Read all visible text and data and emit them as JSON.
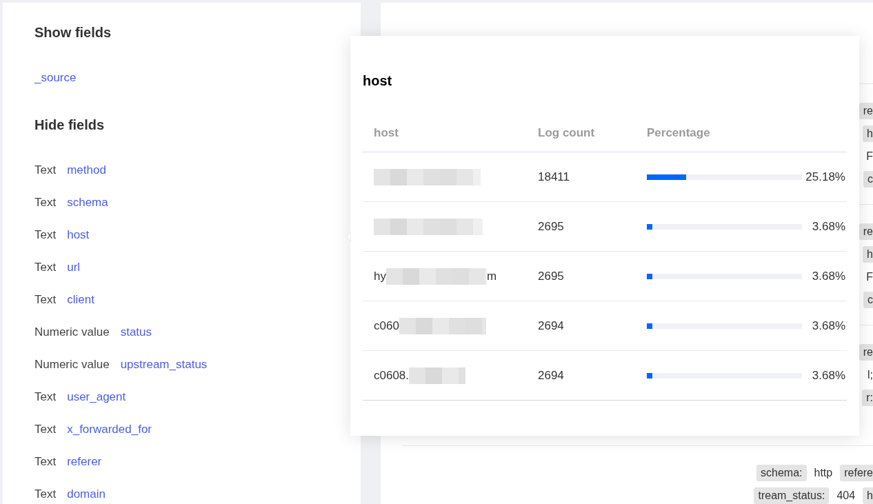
{
  "field_panel": {
    "shown": {
      "title": "Show fields",
      "fields": [
        {
          "name": "_source"
        }
      ]
    },
    "hidden": {
      "title": "Hide fields",
      "fields": [
        {
          "type": "Text",
          "name": "method"
        },
        {
          "type": "Text",
          "name": "schema"
        },
        {
          "type": "Text",
          "name": "host"
        },
        {
          "type": "Text",
          "name": "url"
        },
        {
          "type": "Text",
          "name": "client"
        },
        {
          "type": "Numeric value",
          "name": "status"
        },
        {
          "type": "Numeric value",
          "name": "upstream_status"
        },
        {
          "type": "Text",
          "name": "user_agent"
        },
        {
          "type": "Text",
          "name": "x_forwarded_for"
        },
        {
          "type": "Text",
          "name": "referer"
        },
        {
          "type": "Text",
          "name": "domain"
        }
      ]
    }
  },
  "field_popover": {
    "title": "host",
    "columns": [
      "host",
      "Log count",
      "Percentage"
    ],
    "rows": [
      {
        "redacted": true,
        "count": "18411",
        "level": 0.2518,
        "percentage": "25.18%"
      },
      {
        "redacted": true,
        "count": "2695",
        "level": 0.0368,
        "percentage": "3.68%"
      },
      {
        "host_start": "hy",
        "redacted": true,
        "host_end": "m",
        "count": "2695",
        "level": 0.0368,
        "percentage": "3.68%"
      },
      {
        "host_start": "c060",
        "redacted": true,
        "count": "2694",
        "level": 0.0368,
        "percentage": "3.68%"
      },
      {
        "host_start": "c0608.",
        "redacted": true,
        "count": "2694",
        "level": 0.0368,
        "percentage": "3.68%"
      }
    ]
  },
  "log_entries": [
    {
      "lines": [
        [
          {
            "kind": "key",
            "text": "re"
          }
        ],
        [
          {
            "kind": "key",
            "text": "h"
          }
        ],
        [
          {
            "kind": "value",
            "text": "F"
          }
        ],
        [
          {
            "kind": "key",
            "text": "c"
          }
        ]
      ]
    },
    {
      "lines": [
        [
          {
            "kind": "key",
            "text": "re"
          }
        ],
        [
          {
            "kind": "key",
            "text": "h"
          }
        ],
        [
          {
            "kind": "value",
            "text": "F"
          }
        ],
        [
          {
            "kind": "key",
            "text": "c"
          }
        ]
      ]
    },
    {
      "lines": [
        [
          {
            "kind": "key",
            "text": "re"
          }
        ],
        [
          {
            "kind": "value",
            "text": "l;"
          }
        ],
        [
          {
            "kind": "key",
            "text": "r:"
          }
        ]
      ]
    },
    {
      "lines": [
        [
          {
            "kind": "key",
            "text": "schema:"
          },
          {
            "kind": "value",
            "text": "http"
          },
          {
            "kind": "key",
            "text": "refere"
          }
        ],
        [
          {
            "kind": "key",
            "text": "tream_status:"
          },
          {
            "kind": "value",
            "text": "404"
          },
          {
            "kind": "key",
            "text": "h"
          }
        ]
      ]
    }
  ]
}
